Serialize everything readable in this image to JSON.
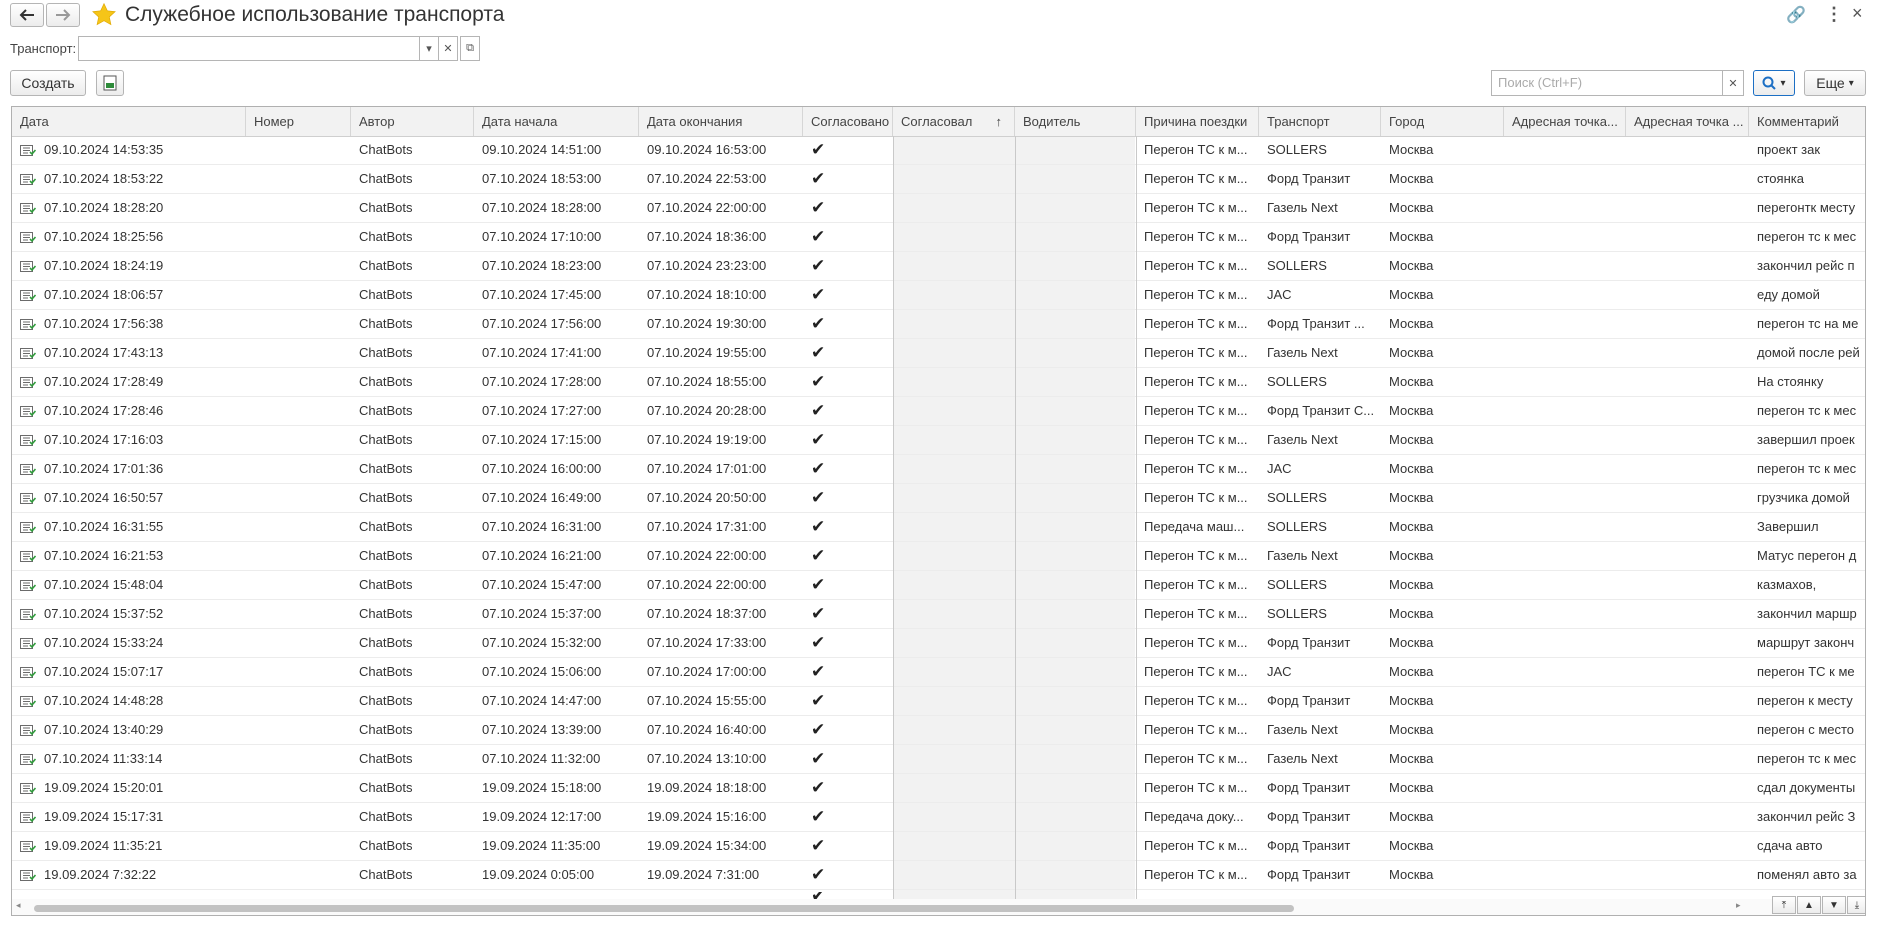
{
  "window": {
    "title": "Служебное использование транспорта"
  },
  "filter": {
    "label": "Транспорт:",
    "value": ""
  },
  "toolbar": {
    "create_label": "Создать",
    "more_label": "Еще",
    "search_placeholder": "Поиск (Ctrl+F)"
  },
  "columns": {
    "date": "Дата",
    "number": "Номер",
    "author": "Автор",
    "start": "Дата начала",
    "end": "Дата окончания",
    "approved": "Согласовано",
    "approver": "Согласовал",
    "driver": "Водитель",
    "reason": "Причина поездки",
    "transport": "Транспорт",
    "city": "Город",
    "addr1": "Адресная точка...",
    "addr2": "Адресная точка ...",
    "comment": "Комментарий"
  },
  "rows": [
    {
      "date": "09.10.2024 14:53:35",
      "author": "ChatBots",
      "start": "09.10.2024 14:51:00",
      "end": "09.10.2024 16:53:00",
      "reason": "Перегон ТС к м...",
      "transport": "SOLLERS",
      "city": "Москва",
      "comment": "проект          зак"
    },
    {
      "date": "07.10.2024 18:53:22",
      "author": "ChatBots",
      "start": "07.10.2024 18:53:00",
      "end": "07.10.2024 22:53:00",
      "reason": "Перегон ТС к м...",
      "transport": "Форд Транзит",
      "city": "Москва",
      "comment": "стоянка"
    },
    {
      "date": "07.10.2024 18:28:20",
      "author": "ChatBots",
      "start": "07.10.2024 18:28:00",
      "end": "07.10.2024 22:00:00",
      "reason": "Перегон ТС к м...",
      "transport": "Газель Next",
      "city": "Москва",
      "comment": "перегонтк месту"
    },
    {
      "date": "07.10.2024 18:25:56",
      "author": "ChatBots",
      "start": "07.10.2024 17:10:00",
      "end": "07.10.2024 18:36:00",
      "reason": "Перегон ТС к м...",
      "transport": "Форд Транзит",
      "city": "Москва",
      "comment": "перегон тс к мес"
    },
    {
      "date": "07.10.2024 18:24:19",
      "author": "ChatBots",
      "start": "07.10.2024 18:23:00",
      "end": "07.10.2024 23:23:00",
      "reason": "Перегон ТС к м...",
      "transport": "SOLLERS",
      "city": "Москва",
      "comment": "закончил рейс п"
    },
    {
      "date": "07.10.2024 18:06:57",
      "author": "ChatBots",
      "start": "07.10.2024 17:45:00",
      "end": "07.10.2024 18:10:00",
      "reason": "Перегон ТС к м...",
      "transport": "JAC",
      "city": "Москва",
      "comment": "еду домой"
    },
    {
      "date": "07.10.2024 17:56:38",
      "author": "ChatBots",
      "start": "07.10.2024 17:56:00",
      "end": "07.10.2024 19:30:00",
      "reason": "Перегон ТС к м...",
      "transport": "Форд Транзит ...",
      "city": "Москва",
      "comment": "перегон тс на ме"
    },
    {
      "date": "07.10.2024 17:43:13",
      "author": "ChatBots",
      "start": "07.10.2024 17:41:00",
      "end": "07.10.2024 19:55:00",
      "reason": "Перегон ТС к м...",
      "transport": "Газель Next",
      "city": "Москва",
      "comment": "домой после рей"
    },
    {
      "date": "07.10.2024 17:28:49",
      "author": "ChatBots",
      "start": "07.10.2024 17:28:00",
      "end": "07.10.2024 18:55:00",
      "reason": "Перегон ТС к м...",
      "transport": "SOLLERS",
      "city": "Москва",
      "comment": "На стоянку"
    },
    {
      "date": "07.10.2024 17:28:46",
      "author": "ChatBots",
      "start": "07.10.2024 17:27:00",
      "end": "07.10.2024 20:28:00",
      "reason": "Перегон ТС к м...",
      "transport": "Форд Транзит С...",
      "city": "Москва",
      "comment": "перегон тс к мес"
    },
    {
      "date": "07.10.2024 17:16:03",
      "author": "ChatBots",
      "start": "07.10.2024 17:15:00",
      "end": "07.10.2024 19:19:00",
      "reason": "Перегон ТС к м...",
      "transport": "Газель Next",
      "city": "Москва",
      "comment": "завершил проек"
    },
    {
      "date": "07.10.2024 17:01:36",
      "author": "ChatBots",
      "start": "07.10.2024 16:00:00",
      "end": "07.10.2024 17:01:00",
      "reason": "Перегон ТС к м...",
      "transport": "JAC",
      "city": "Москва",
      "comment": "перегон тс к мес"
    },
    {
      "date": "07.10.2024 16:50:57",
      "author": "ChatBots",
      "start": "07.10.2024 16:49:00",
      "end": "07.10.2024 20:50:00",
      "reason": "Перегон ТС к м...",
      "transport": "SOLLERS",
      "city": "Москва",
      "comment": "грузчика домой"
    },
    {
      "date": "07.10.2024 16:31:55",
      "author": "ChatBots",
      "start": "07.10.2024 16:31:00",
      "end": "07.10.2024 17:31:00",
      "reason": "Передача маш...",
      "transport": "SOLLERS",
      "city": "Москва",
      "comment": "Завершил"
    },
    {
      "date": "07.10.2024 16:21:53",
      "author": "ChatBots",
      "start": "07.10.2024 16:21:00",
      "end": "07.10.2024 22:00:00",
      "reason": "Перегон ТС к м...",
      "transport": "Газель Next",
      "city": "Москва",
      "comment": "Матус перегон д"
    },
    {
      "date": "07.10.2024 15:48:04",
      "author": "ChatBots",
      "start": "07.10.2024 15:47:00",
      "end": "07.10.2024 22:00:00",
      "reason": "Перегон ТС к м...",
      "transport": "SOLLERS",
      "city": "Москва",
      "comment": "казмахов,"
    },
    {
      "date": "07.10.2024 15:37:52",
      "author": "ChatBots",
      "start": "07.10.2024 15:37:00",
      "end": "07.10.2024 18:37:00",
      "reason": "Перегон ТС к м...",
      "transport": "SOLLERS",
      "city": "Москва",
      "comment": "закончил маршр"
    },
    {
      "date": "07.10.2024 15:33:24",
      "author": "ChatBots",
      "start": "07.10.2024 15:32:00",
      "end": "07.10.2024 17:33:00",
      "reason": "Перегон ТС к м...",
      "transport": "Форд Транзит",
      "city": "Москва",
      "comment": "маршрут законч"
    },
    {
      "date": "07.10.2024 15:07:17",
      "author": "ChatBots",
      "start": "07.10.2024 15:06:00",
      "end": "07.10.2024 17:00:00",
      "reason": "Перегон ТС к м...",
      "transport": "JAC",
      "city": "Москва",
      "comment": "перегон ТС к ме"
    },
    {
      "date": "07.10.2024 14:48:28",
      "author": "ChatBots",
      "start": "07.10.2024 14:47:00",
      "end": "07.10.2024 15:55:00",
      "reason": "Перегон ТС к м...",
      "transport": "Форд Транзит",
      "city": "Москва",
      "comment": "перегон к месту"
    },
    {
      "date": "07.10.2024 13:40:29",
      "author": "ChatBots",
      "start": "07.10.2024 13:39:00",
      "end": "07.10.2024 16:40:00",
      "reason": "Перегон ТС к м...",
      "transport": "Газель Next",
      "city": "Москва",
      "comment": "перегон с место"
    },
    {
      "date": "07.10.2024 11:33:14",
      "author": "ChatBots",
      "start": "07.10.2024 11:32:00",
      "end": "07.10.2024 13:10:00",
      "reason": "Перегон ТС к м...",
      "transport": "Газель Next",
      "city": "Москва",
      "comment": "перегон тс к мес"
    },
    {
      "date": "19.09.2024 15:20:01",
      "author": "ChatBots",
      "start": "19.09.2024 15:18:00",
      "end": "19.09.2024 18:18:00",
      "reason": "Перегон ТС к м...",
      "transport": "Форд Транзит",
      "city": "Москва",
      "comment": "сдал документы"
    },
    {
      "date": "19.09.2024 15:17:31",
      "author": "ChatBots",
      "start": "19.09.2024 12:17:00",
      "end": "19.09.2024 15:16:00",
      "reason": "Передача доку...",
      "transport": "Форд Транзит",
      "city": "Москва",
      "comment": "закончил рейс З"
    },
    {
      "date": "19.09.2024 11:35:21",
      "author": "ChatBots",
      "start": "19.09.2024 11:35:00",
      "end": "19.09.2024 15:34:00",
      "reason": "Перегон ТС к м...",
      "transport": "Форд Транзит",
      "city": "Москва",
      "comment": "сдача авто"
    },
    {
      "date": "19.09.2024 7:32:22",
      "author": "ChatBots",
      "start": "19.09.2024 0:05:00",
      "end": "19.09.2024 7:31:00",
      "reason": "Перегон ТС к м...",
      "transport": "Форд Транзит",
      "city": "Москва",
      "comment": "поменял авто за"
    }
  ],
  "colors": {
    "star": "#f5c518",
    "header_bg": "#f2f2f2",
    "border": "#b5b5b5"
  }
}
